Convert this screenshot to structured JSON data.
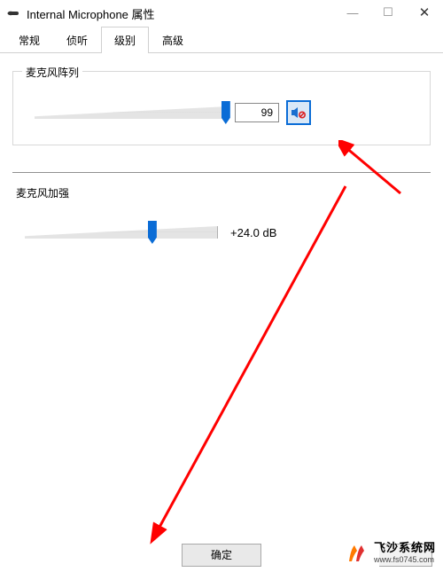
{
  "window": {
    "title": "Internal Microphone 属性",
    "controls": {
      "minimize": "—",
      "maximize": "☐",
      "close": "✕"
    }
  },
  "tabs": [
    {
      "label": "常规",
      "active": false
    },
    {
      "label": "侦听",
      "active": false
    },
    {
      "label": "级别",
      "active": true
    },
    {
      "label": "高级",
      "active": false
    }
  ],
  "mic_array": {
    "group_label": "麦克风阵列",
    "value": "99",
    "slider_percent": 99,
    "mute_icon": "speaker-muted-icon"
  },
  "mic_boost": {
    "group_label": "麦克风加强",
    "value": "+24.0 dB",
    "slider_percent": 66
  },
  "buttons": {
    "ok": "确定"
  },
  "watermark": {
    "name": "飞沙系统网",
    "url": "www.fs0745.com"
  }
}
